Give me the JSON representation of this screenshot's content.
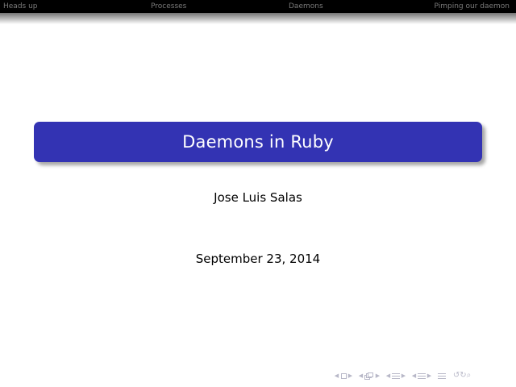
{
  "nav": {
    "items": [
      {
        "label": "Heads up"
      },
      {
        "label": "Processes"
      },
      {
        "label": "Daemons"
      },
      {
        "label": "Pimping our daemon"
      }
    ]
  },
  "slide": {
    "title": "Daemons in Ruby",
    "author": "Jose Luis Salas",
    "date": "September 23, 2014"
  },
  "beamer_controls": {
    "icons": [
      "arrow-left-icon",
      "slide-icon",
      "arrow-right-icon",
      "frame-icon",
      "subsection-icon",
      "section-icon",
      "align-icon",
      "search-icon"
    ]
  },
  "colors": {
    "title_box": "#3333b3",
    "nav_bar": "#000000",
    "nav_text": "#7a7a7a",
    "controls": "#b8b8c8"
  }
}
